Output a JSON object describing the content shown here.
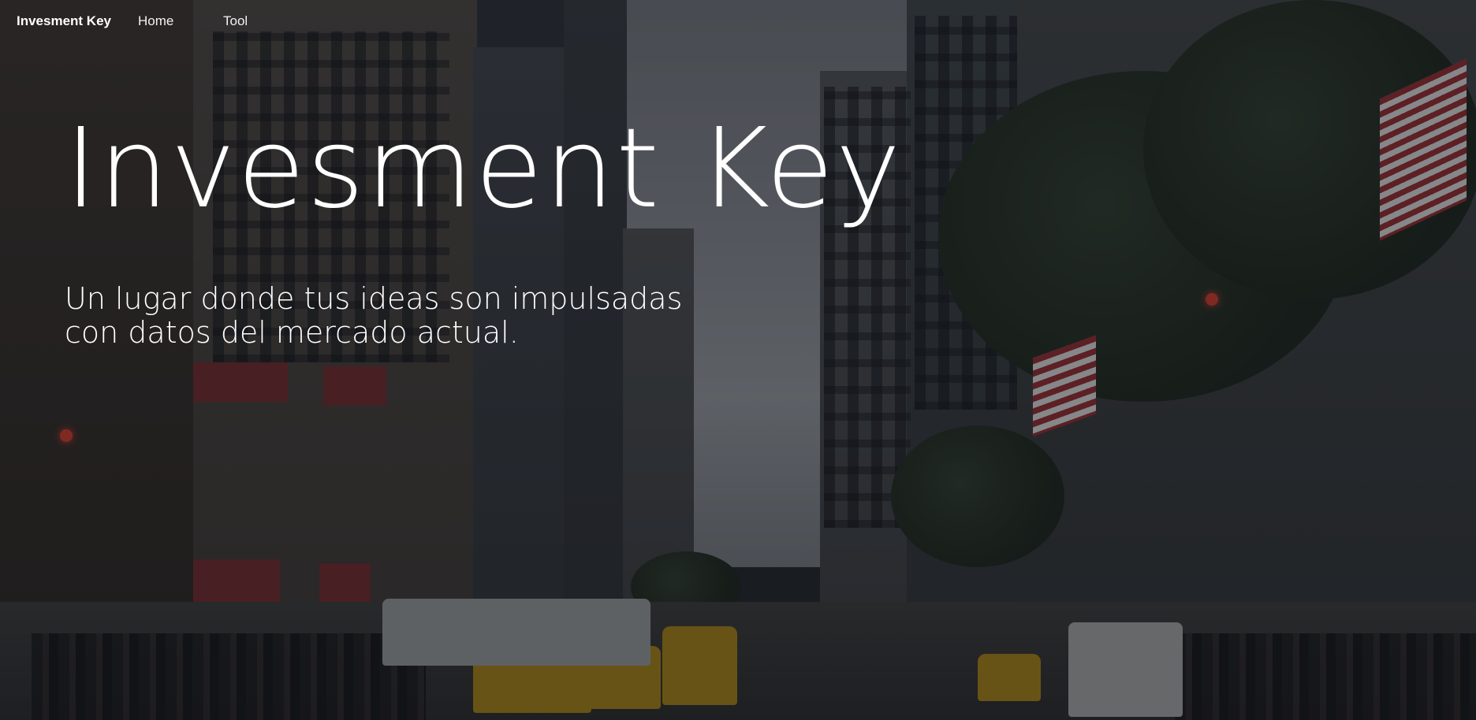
{
  "nav": {
    "brand": "Invesment Key",
    "links": [
      {
        "label": "Home"
      },
      {
        "label": "Tool"
      }
    ]
  },
  "hero": {
    "title": "Invesment Key",
    "subtitle_line1": "Un lugar donde tus ideas son impulsadas",
    "subtitle_line2": "con datos del mercado actual.",
    "background": "city-street-photo"
  },
  "colors": {
    "text": "#ffffff",
    "overlay": "rgba(10,12,16,0.35)"
  }
}
